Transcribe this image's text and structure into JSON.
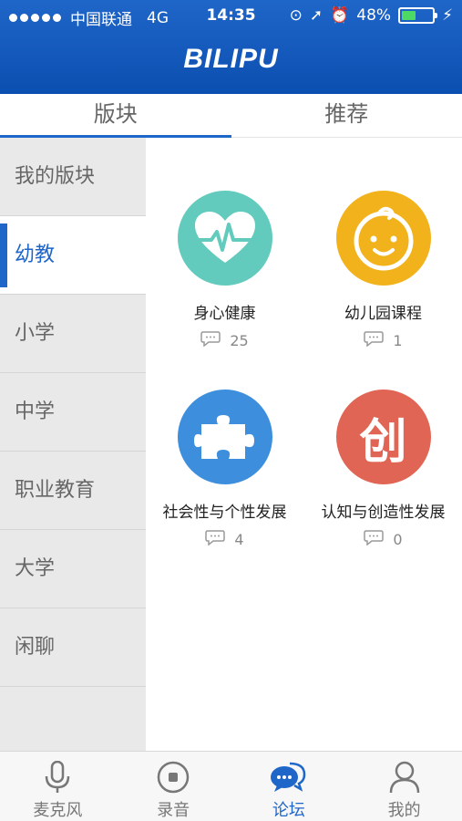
{
  "status_bar": {
    "carrier": "中国联通",
    "network": "4G",
    "time": "14:35",
    "battery": "48%",
    "battery_level": 0.48
  },
  "header": {
    "logo_text": "BILIPU"
  },
  "tabs": [
    {
      "label": "版块",
      "active": true
    },
    {
      "label": "推荐",
      "active": false
    }
  ],
  "sidebar": {
    "items": [
      {
        "label": "我的版块"
      },
      {
        "label": "幼教"
      },
      {
        "label": "小学"
      },
      {
        "label": "中学"
      },
      {
        "label": "职业教育"
      },
      {
        "label": "大学"
      },
      {
        "label": "闲聊"
      }
    ],
    "active_index": 1
  },
  "forums": [
    {
      "title": "身心健康",
      "count": "25",
      "color": "#62cbbd",
      "icon": "heart-pulse-icon"
    },
    {
      "title": "幼儿园课程",
      "count": "1",
      "color": "#f2b21b",
      "icon": "baby-face-icon"
    },
    {
      "title": "社会性与个性发展",
      "count": "4",
      "color": "#3d8fde",
      "icon": "puzzle-icon"
    },
    {
      "title": "认知与创造性发展",
      "count": "0",
      "color": "#e06554",
      "icon": "chuang-icon",
      "icon_text": "创"
    }
  ],
  "bottom_tabs": [
    {
      "label": "麦克风",
      "icon": "microphone-icon",
      "active": false
    },
    {
      "label": "录音",
      "icon": "record-icon",
      "active": false
    },
    {
      "label": "论坛",
      "icon": "chat-bubbles-icon",
      "active": true
    },
    {
      "label": "我的",
      "icon": "person-icon",
      "active": false
    }
  ],
  "colors": {
    "brand": "#1f66c9",
    "active_tab": "#1f66c9",
    "sidebar_bg": "#e9e9e9"
  }
}
